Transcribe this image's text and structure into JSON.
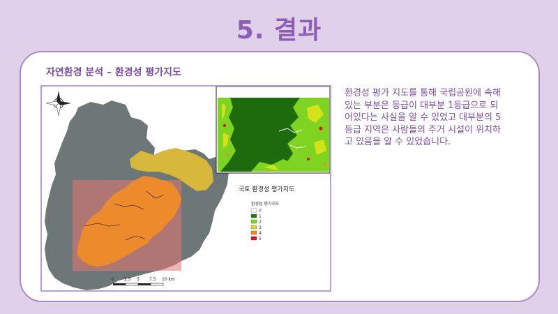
{
  "slide": {
    "title": "5. 결과"
  },
  "content": {
    "subtitle": "자연환경 분석 – 환경성 평가지도",
    "description": "환경성 평가 지도를 통해 국립공원에 속해있는 부분은 등급이 대부분 1등급으로 되어있다는 사실을 알 수 있었고 대부분의 5등급 지역은 사람들의 주거 시설이 위치하고 있음을 알 수 있었습니다."
  },
  "map": {
    "inset_caption": "국토 환경성 평가지도",
    "legend": {
      "title": "환경성 평가지도",
      "items": [
        {
          "label": "0",
          "color": "#ffffff"
        },
        {
          "label": "1",
          "color": "#1f7a0a"
        },
        {
          "label": "2",
          "color": "#7fd321"
        },
        {
          "label": "3",
          "color": "#d4e21a"
        },
        {
          "label": "4",
          "color": "#f08a1c"
        },
        {
          "label": "5",
          "color": "#e01010"
        }
      ]
    },
    "scale": {
      "ticks": [
        "0",
        "2.5",
        "5",
        "7.5",
        "10 km"
      ]
    }
  },
  "colors": {
    "title": "#8c5fb4",
    "text": "#7a4ea6",
    "background": "#e0d0ea",
    "card_border": "#a98ac8"
  }
}
